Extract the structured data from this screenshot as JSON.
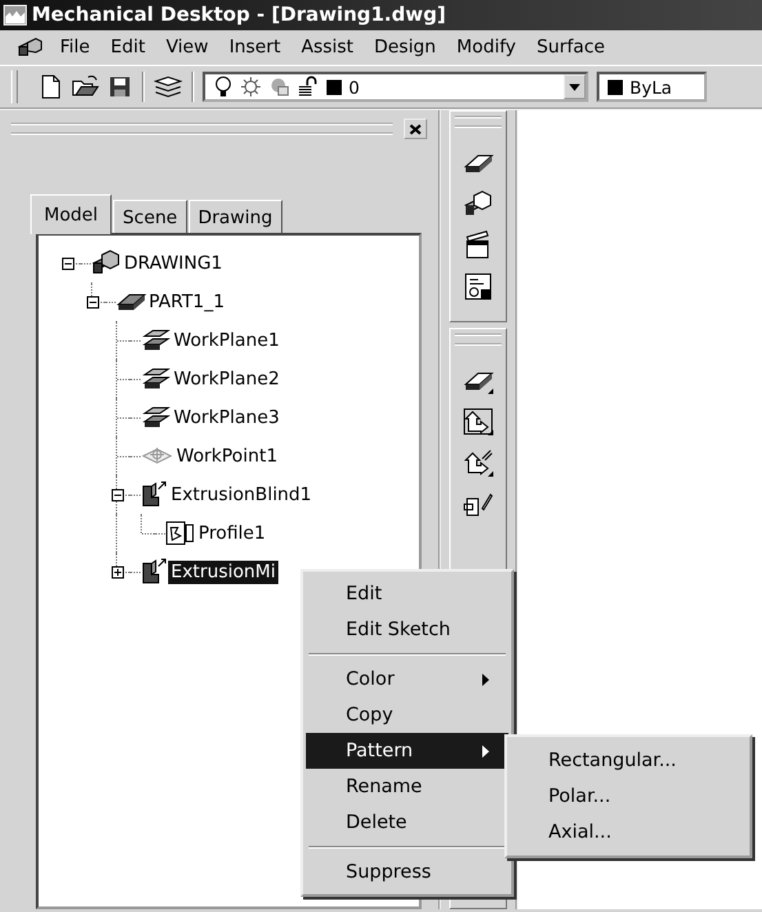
{
  "window": {
    "title": "Mechanical Desktop - [Drawing1.dwg]"
  },
  "menu_bar": [
    "File",
    "Edit",
    "View",
    "Insert",
    "Assist",
    "Design",
    "Modify",
    "Surface"
  ],
  "toolbar": {
    "layer_value": "0",
    "color_value": "ByLa"
  },
  "browser": {
    "tabs": [
      {
        "label": "Model",
        "selected": true
      },
      {
        "label": "Scene",
        "selected": false
      },
      {
        "label": "Drawing",
        "selected": false
      }
    ],
    "tree": [
      {
        "label": "DRAWING1",
        "kind": "assembly",
        "expanded": true,
        "selected": false,
        "children": [
          {
            "label": "PART1_1",
            "kind": "part",
            "expanded": true,
            "selected": false,
            "children": [
              {
                "label": "WorkPlane1",
                "kind": "workplane",
                "selected": false
              },
              {
                "label": "WorkPlane2",
                "kind": "workplane",
                "selected": false
              },
              {
                "label": "WorkPlane3",
                "kind": "workplane",
                "selected": false
              },
              {
                "label": "WorkPoint1",
                "kind": "workpoint",
                "selected": false
              },
              {
                "label": "ExtrusionBlind1",
                "kind": "extrusion",
                "expanded": true,
                "selected": false,
                "children": [
                  {
                    "label": "Profile1",
                    "kind": "profile",
                    "selected": false
                  }
                ]
              },
              {
                "label": "ExtrusionMi",
                "kind": "extrusion",
                "expanded": false,
                "selected": true
              }
            ]
          }
        ]
      }
    ]
  },
  "context_menu": {
    "groups": [
      [
        {
          "label": "Edit",
          "submenu": false,
          "selected": false
        },
        {
          "label": "Edit Sketch",
          "submenu": false,
          "selected": false
        }
      ],
      [
        {
          "label": "Color",
          "submenu": true,
          "selected": false
        },
        {
          "label": "Copy",
          "submenu": false,
          "selected": false
        },
        {
          "label": "Pattern",
          "submenu": true,
          "selected": true
        },
        {
          "label": "Rename",
          "submenu": false,
          "selected": false
        },
        {
          "label": "Delete",
          "submenu": false,
          "selected": false
        }
      ],
      [
        {
          "label": "Suppress",
          "submenu": false,
          "selected": false
        }
      ]
    ]
  },
  "submenu": {
    "items": [
      "Rectangular...",
      "Polar...",
      "Axial..."
    ]
  }
}
